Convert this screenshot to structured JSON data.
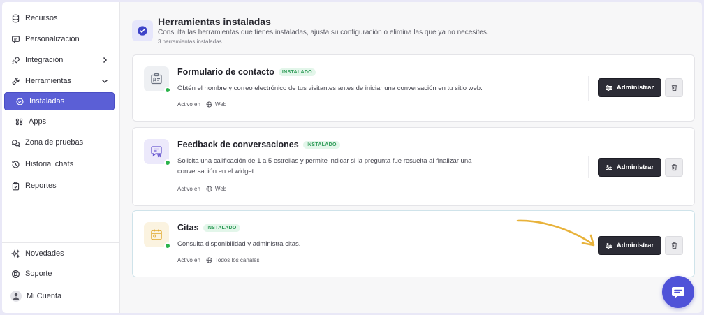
{
  "sidebar": {
    "items": [
      {
        "label": "Recursos",
        "icon": "database-icon"
      },
      {
        "label": "Personalización",
        "icon": "message-square-icon"
      },
      {
        "label": "Integración",
        "icon": "rocket-icon"
      },
      {
        "label": "Herramientas",
        "icon": "wrench-icon"
      },
      {
        "label": "Instaladas",
        "icon": "check-circle-icon"
      },
      {
        "label": "Apps",
        "icon": "grid-icon"
      },
      {
        "label": "Zona de pruebas",
        "icon": "chat-bubbles-icon"
      },
      {
        "label": "Historial chats",
        "icon": "history-icon"
      },
      {
        "label": "Reportes",
        "icon": "clipboard-icon"
      }
    ],
    "footer": [
      {
        "label": "Novedades",
        "icon": "sparkles-icon"
      },
      {
        "label": "Soporte",
        "icon": "lifebuoy-icon"
      },
      {
        "label": "Mi Cuenta",
        "icon": "user-icon"
      }
    ]
  },
  "header": {
    "title": "Herramientas instaladas",
    "description": "Consulta las herramientas que tienes instaladas, ajusta su configuración o elimina las que ya no necesites.",
    "count": "3 herramientas instaladas"
  },
  "tools": [
    {
      "title": "Formulario de contacto",
      "badge": "INSTALADO",
      "description": "Obtén el nombre y correo electrónico de tus visitantes antes de iniciar una conversación en tu sitio web.",
      "active_label": "Activo en",
      "channel": "Web",
      "admin_label": "Administrar"
    },
    {
      "title": "Feedback de conversaciones",
      "badge": "INSTALADO",
      "description": "Solicita una calificación de 1 a 5 estrellas y permite indicar si la pregunta fue resuelta al finalizar una conversación en el widget.",
      "active_label": "Activo en",
      "channel": "Web",
      "admin_label": "Administrar"
    },
    {
      "title": "Citas",
      "badge": "INSTALADO",
      "description": "Consulta disponibilidad y administra citas.",
      "active_label": "Activo en",
      "channel": "Todos los canales",
      "admin_label": "Administrar"
    }
  ],
  "colors": {
    "accent": "#5b5fd6",
    "installed_badge": "#2c9a55",
    "status_dot": "#2bb34b",
    "arrow": "#e8b23a",
    "admin_button": "#2c2c36"
  }
}
